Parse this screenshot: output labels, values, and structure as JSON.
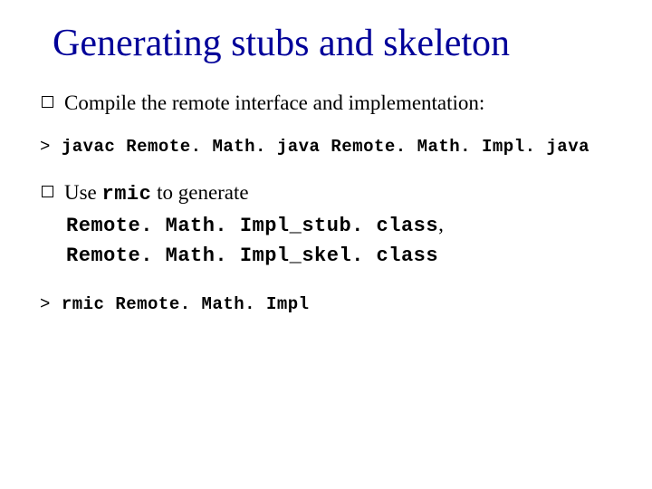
{
  "title": "Generating stubs and skeleton",
  "bullets": {
    "b1_text": "Compile the remote interface and implementation:",
    "b2_prefix": "Use ",
    "b2_cmd": "rmic",
    "b2_suffix": " to generate",
    "b2_line2": "Remote. Math. Impl_stub. class",
    "b2_line2_comma": ",",
    "b2_line3": "Remote. Math. Impl_skel. class"
  },
  "commands": {
    "c1_prompt": "> ",
    "c1_cmd": "javac Remote. Math. java Remote. Math. Impl. java",
    "c2_prompt": "> ",
    "c2_cmd": "rmic Remote. Math. Impl"
  }
}
